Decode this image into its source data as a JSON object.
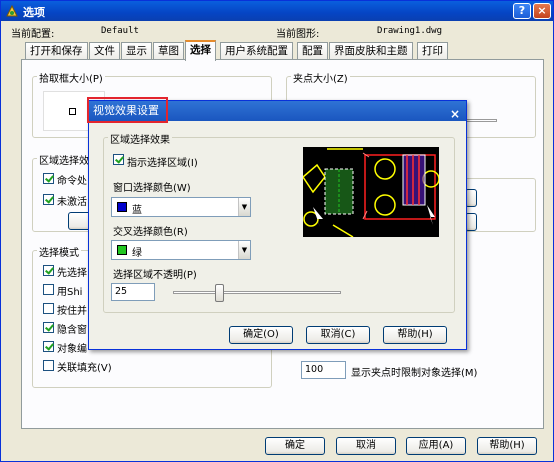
{
  "window": {
    "title": "选项",
    "help_glyph": "?",
    "close_glyph": "×"
  },
  "info": {
    "profile_label": "当前配置:",
    "profile_value": "Default",
    "drawing_label": "当前图形:",
    "drawing_value": "Drawing1.dwg"
  },
  "tabs": [
    "打开和保存",
    "文件",
    "显示",
    "草图",
    "选择",
    "用户系统配置",
    "配置",
    "界面皮肤和主题",
    "打印"
  ],
  "active_tab": "选择",
  "panel": {
    "pickbox_label": "拾取框大小(P)",
    "grip_label": "夹点大小(Z)",
    "selection_preview_label": "区域选择效",
    "cb_command": "命令处",
    "cb_noactive": "未激活",
    "selection_mode_label": "选择模式",
    "mode_items": [
      {
        "label": "先选择",
        "checked": true
      },
      {
        "label": "用Shi",
        "checked": false
      },
      {
        "label": "按住并",
        "checked": false
      },
      {
        "label": "隐含窗",
        "checked": true
      },
      {
        "label": "对象编",
        "checked": true
      },
      {
        "label": "关联填充(V)",
        "checked": false
      }
    ],
    "grip_limit_value": "100",
    "grip_limit_label": "显示夹点时限制对象选择(M)"
  },
  "dialog": {
    "title": "视觉效果设置",
    "close_glyph": "×",
    "group_label": "区域选择效果",
    "indicate_label": "指示选择区域(I)",
    "window_color_label": "窗口选择颜色(W)",
    "window_color_value": "蓝",
    "cross_color_label": "交叉选择颜色(R)",
    "cross_color_value": "绿",
    "opacity_label": "选择区域不透明(P)",
    "opacity_value": "25",
    "ok": "确定(O)",
    "cancel": "取消(C)",
    "help": "帮助(H)"
  },
  "footer": {
    "ok": "确定",
    "cancel": "取消",
    "apply": "应用(A)",
    "help": "帮助(H)"
  },
  "colors": {
    "window_color": "#0000cc",
    "cross_color": "#22c622",
    "accent": "#e3252e"
  },
  "opacity_slider_fraction": 0.25
}
